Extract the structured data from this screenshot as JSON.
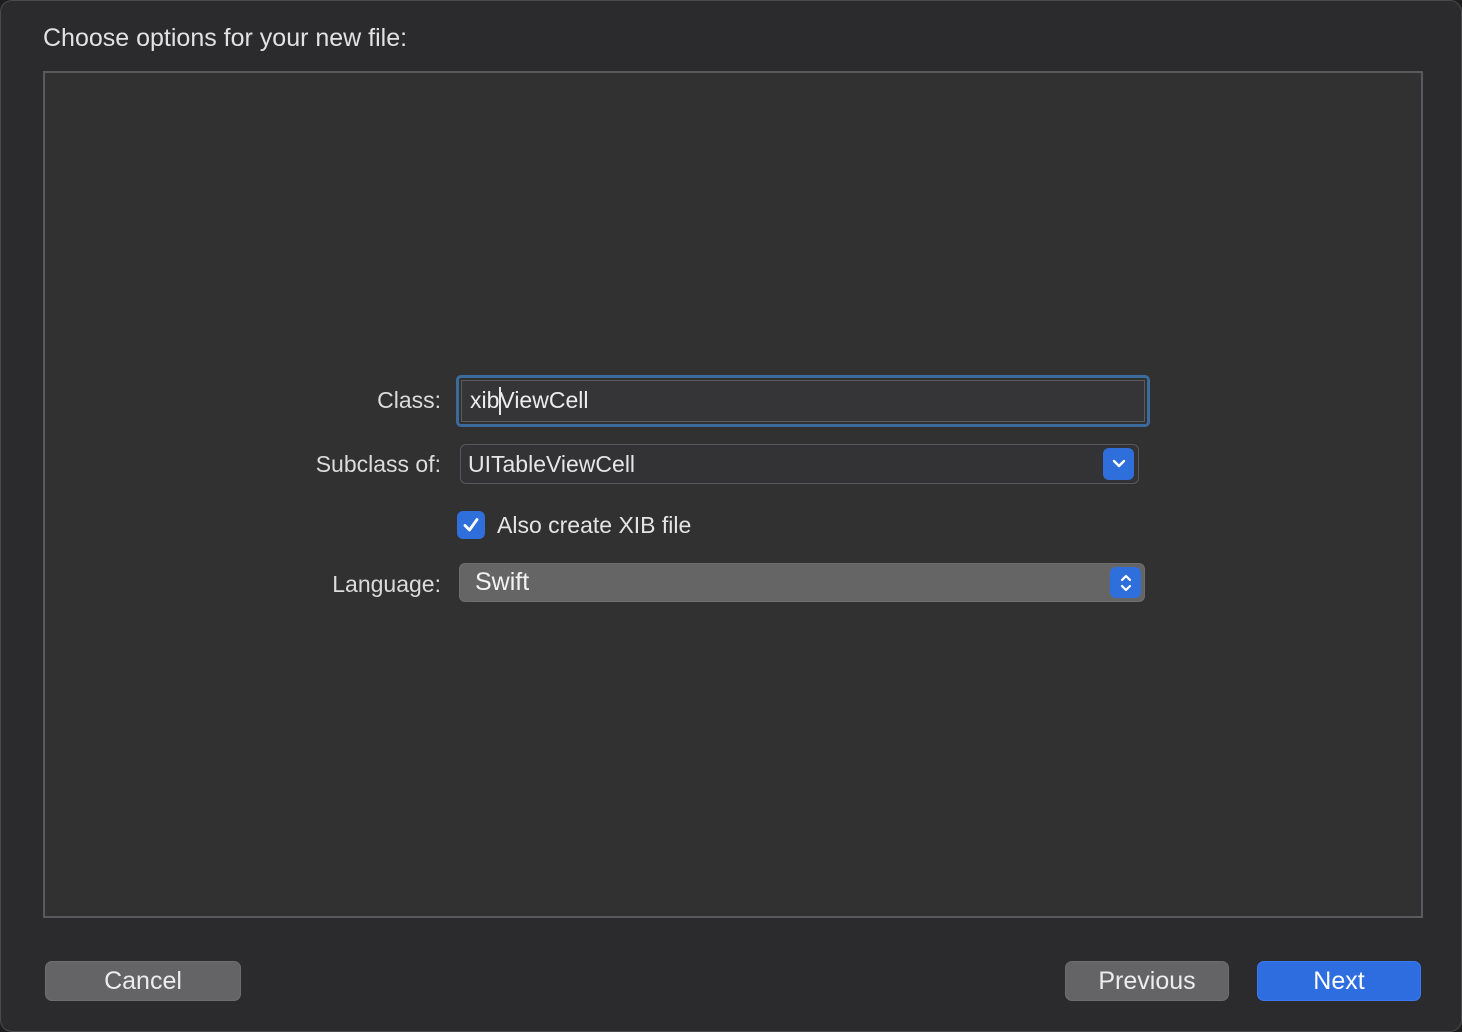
{
  "dialog": {
    "title": "Choose options for your new file:"
  },
  "form": {
    "class_label": "Class:",
    "class_value": "xibViewCell",
    "subclass_label": "Subclass of:",
    "subclass_value": "UITableViewCell",
    "xib_checkbox_label": "Also create XIB file",
    "xib_checked": true,
    "language_label": "Language:",
    "language_value": "Swift"
  },
  "buttons": {
    "cancel": "Cancel",
    "previous": "Previous",
    "next": "Next"
  },
  "icons": {
    "combo": "chevron-down-icon",
    "popup": "up-down-chevron-icon",
    "checkbox": "checkmark-icon"
  },
  "colors": {
    "accent": "#2f6fdc",
    "focus_ring": "#3c6a9c",
    "background": "#2b2b2d"
  }
}
